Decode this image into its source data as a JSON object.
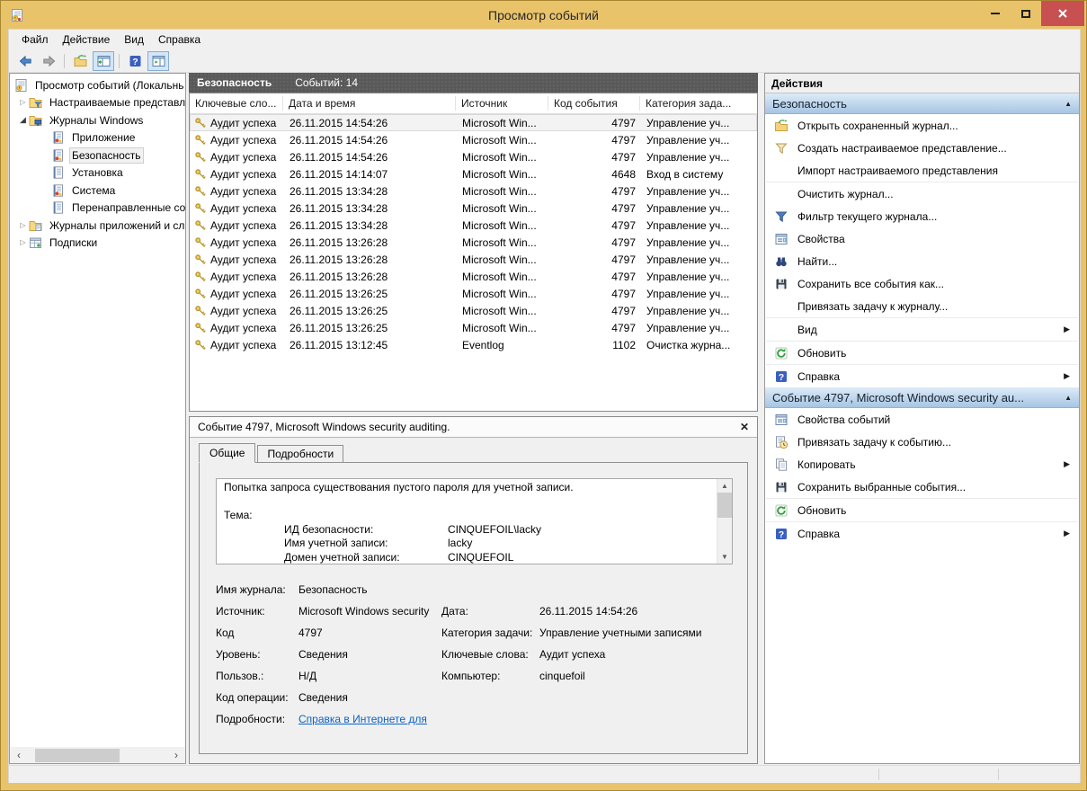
{
  "window": {
    "title": "Просмотр событий",
    "controls": [
      "minimize",
      "maximize",
      "close"
    ]
  },
  "menu": {
    "items": [
      "Файл",
      "Действие",
      "Вид",
      "Справка"
    ]
  },
  "toolbar": {
    "buttons": [
      {
        "icon": "back"
      },
      {
        "icon": "forward"
      },
      {
        "sep": true
      },
      {
        "icon": "open-saved-log"
      },
      {
        "icon": "console-tree-toggle",
        "active": true
      },
      {
        "sep": true
      },
      {
        "icon": "help"
      },
      {
        "icon": "action-pane-toggle",
        "active": true
      }
    ]
  },
  "tree": {
    "items": [
      {
        "level": 0,
        "icon": "event-viewer",
        "label": "Просмотр событий (Локальнь"
      },
      {
        "level": 1,
        "icon": "custom-views-folder",
        "label": "Настраиваемые представле",
        "expand": "collapsed"
      },
      {
        "level": 1,
        "icon": "windows-logs-folder",
        "label": "Журналы Windows",
        "expand": "expanded"
      },
      {
        "level": 2,
        "icon": "log-alert",
        "label": "Приложение"
      },
      {
        "level": 2,
        "icon": "log-alert",
        "label": "Безопасность",
        "selected": true
      },
      {
        "level": 2,
        "icon": "log",
        "label": "Установка"
      },
      {
        "level": 2,
        "icon": "log-alert",
        "label": "Система"
      },
      {
        "level": 2,
        "icon": "log",
        "label": "Перенаправленные соб"
      },
      {
        "level": 1,
        "icon": "apps-logs-folder",
        "label": "Журналы приложений и сл",
        "expand": "collapsed"
      },
      {
        "level": 1,
        "icon": "subscriptions",
        "label": "Подписки"
      }
    ]
  },
  "list": {
    "title": "Безопасность",
    "count_label": "Событий: 14",
    "columns": [
      "Ключевые сло...",
      "Дата и время",
      "Источник",
      "Код события",
      "Категория зада..."
    ],
    "rows": [
      {
        "keywords": "Аудит успеха",
        "datetime": "26.11.2015 14:54:26",
        "source": "Microsoft Win...",
        "event_id": "4797",
        "category": "Управление уч...",
        "selected": true
      },
      {
        "keywords": "Аудит успеха",
        "datetime": "26.11.2015 14:54:26",
        "source": "Microsoft Win...",
        "event_id": "4797",
        "category": "Управление уч..."
      },
      {
        "keywords": "Аудит успеха",
        "datetime": "26.11.2015 14:54:26",
        "source": "Microsoft Win...",
        "event_id": "4797",
        "category": "Управление уч..."
      },
      {
        "keywords": "Аудит успеха",
        "datetime": "26.11.2015 14:14:07",
        "source": "Microsoft Win...",
        "event_id": "4648",
        "category": "Вход в систему"
      },
      {
        "keywords": "Аудит успеха",
        "datetime": "26.11.2015 13:34:28",
        "source": "Microsoft Win...",
        "event_id": "4797",
        "category": "Управление уч..."
      },
      {
        "keywords": "Аудит успеха",
        "datetime": "26.11.2015 13:34:28",
        "source": "Microsoft Win...",
        "event_id": "4797",
        "category": "Управление уч..."
      },
      {
        "keywords": "Аудит успеха",
        "datetime": "26.11.2015 13:34:28",
        "source": "Microsoft Win...",
        "event_id": "4797",
        "category": "Управление уч..."
      },
      {
        "keywords": "Аудит успеха",
        "datetime": "26.11.2015 13:26:28",
        "source": "Microsoft Win...",
        "event_id": "4797",
        "category": "Управление уч..."
      },
      {
        "keywords": "Аудит успеха",
        "datetime": "26.11.2015 13:26:28",
        "source": "Microsoft Win...",
        "event_id": "4797",
        "category": "Управление уч..."
      },
      {
        "keywords": "Аудит успеха",
        "datetime": "26.11.2015 13:26:28",
        "source": "Microsoft Win...",
        "event_id": "4797",
        "category": "Управление уч..."
      },
      {
        "keywords": "Аудит успеха",
        "datetime": "26.11.2015 13:26:25",
        "source": "Microsoft Win...",
        "event_id": "4797",
        "category": "Управление уч..."
      },
      {
        "keywords": "Аудит успеха",
        "datetime": "26.11.2015 13:26:25",
        "source": "Microsoft Win...",
        "event_id": "4797",
        "category": "Управление уч..."
      },
      {
        "keywords": "Аудит успеха",
        "datetime": "26.11.2015 13:26:25",
        "source": "Microsoft Win...",
        "event_id": "4797",
        "category": "Управление уч..."
      },
      {
        "keywords": "Аудит успеха",
        "datetime": "26.11.2015 13:12:45",
        "source": "Eventlog",
        "event_id": "1102",
        "category": "Очистка журна..."
      }
    ]
  },
  "details": {
    "title": "Событие 4797, Microsoft Windows security auditing.",
    "tabs": [
      {
        "label": "Общие",
        "active": true
      },
      {
        "label": "Подробности"
      }
    ],
    "message": {
      "intro": "Попытка запроса существования пустого пароля для учетной записи.",
      "section": "Тема:",
      "entries": [
        [
          "ИД безопасности:",
          "CINQUEFOIL\\lacky"
        ],
        [
          "Имя учетной записи:",
          "lacky"
        ],
        [
          "Домен учетной записи:",
          "CINQUEFOIL"
        ]
      ]
    },
    "fields": [
      {
        "label": "Имя журнала:",
        "value": "Безопасность"
      },
      {
        "label": "Источник:",
        "value": "Microsoft Windows security",
        "label2": "Дата:",
        "value2": "26.11.2015 14:54:26"
      },
      {
        "label": "Код",
        "value": "4797",
        "label2": "Категория задачи:",
        "value2": "Управление учетными записями"
      },
      {
        "label": "Уровень:",
        "value": "Сведения",
        "label2": "Ключевые слова:",
        "value2": "Аудит успеха"
      },
      {
        "label": "Пользов.:",
        "value": "Н/Д",
        "label2": "Компьютер:",
        "value2": "cinquefoil"
      },
      {
        "label": "Код операции:",
        "value": "Сведения"
      },
      {
        "label": "Подробности:",
        "value": "Справка в Интернете для ",
        "link": true
      }
    ]
  },
  "actions": {
    "title": "Действия",
    "sections": [
      {
        "title": "Безопасность",
        "items": [
          {
            "icon": "open-saved-log",
            "label": "Открыть сохраненный журнал..."
          },
          {
            "icon": "create-custom-view",
            "label": "Создать настраиваемое представление..."
          },
          {
            "label": "Импорт настраиваемого представления",
            "sep_after": true
          },
          {
            "label": "Очистить журнал..."
          },
          {
            "icon": "filter-current-log",
            "label": "Фильтр текущего журнала..."
          },
          {
            "icon": "properties",
            "label": "Свойства"
          },
          {
            "icon": "find",
            "label": "Найти..."
          },
          {
            "icon": "save",
            "label": "Сохранить все события как..."
          },
          {
            "label": "Привязать задачу к журналу...",
            "sep_after": true
          },
          {
            "label": "Вид",
            "arrow": true,
            "sep_after": true
          },
          {
            "icon": "refresh",
            "label": "Обновить",
            "sep_after": true
          },
          {
            "icon": "help",
            "label": "Справка",
            "arrow": true
          }
        ]
      },
      {
        "title": "Событие 4797, Microsoft Windows security au...",
        "items": [
          {
            "icon": "properties",
            "label": "Свойства событий"
          },
          {
            "icon": "attach-task",
            "label": "Привязать задачу к событию..."
          },
          {
            "icon": "copy",
            "label": "Копировать",
            "arrow": true
          },
          {
            "icon": "save",
            "label": "Сохранить выбранные события...",
            "sep_after": true
          },
          {
            "icon": "refresh",
            "label": "Обновить",
            "sep_after": true
          },
          {
            "icon": "help",
            "label": "Справка",
            "arrow": true
          }
        ]
      }
    ]
  },
  "colors": {
    "titlebar": "#e9c36a",
    "close_button": "#c85050",
    "list_header": "#595959",
    "section_header_top": "#ddebf8",
    "section_header_bottom": "#a6c5e3",
    "link": "#0b62c4"
  }
}
